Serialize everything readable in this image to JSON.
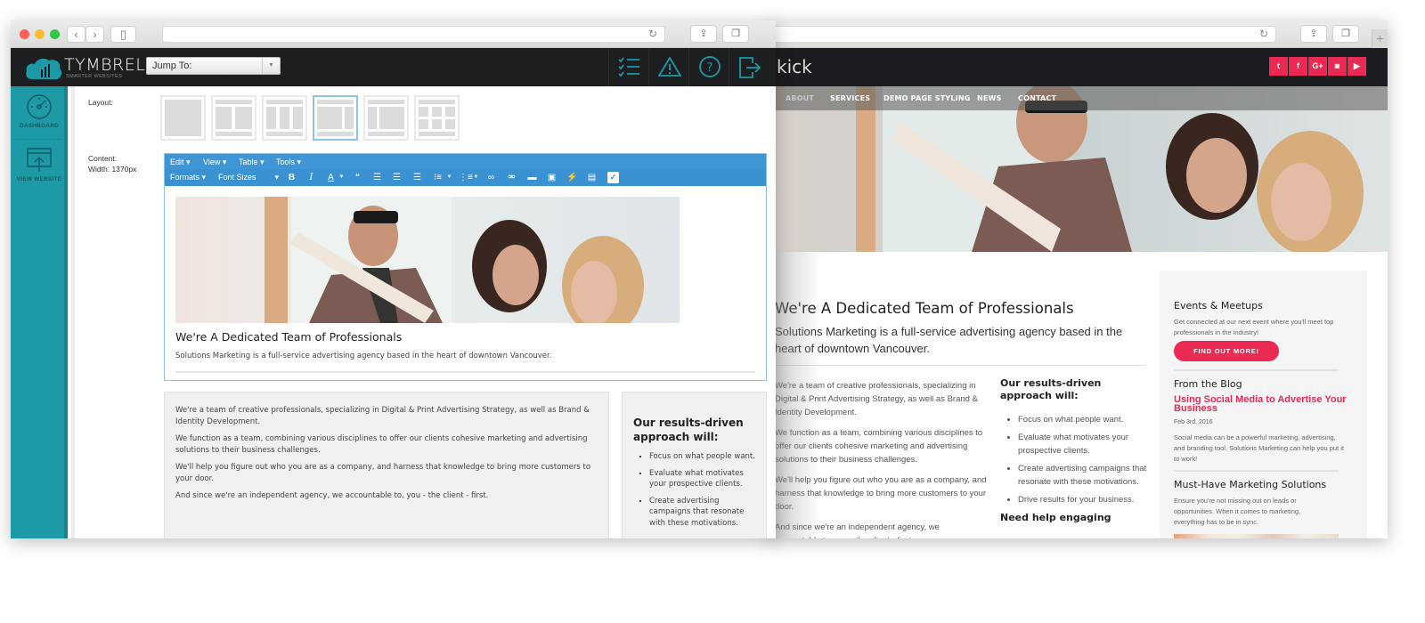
{
  "cms": {
    "brand": "TYMBREL",
    "brand_tagline": "SMARTER WEBSITES",
    "jump_to": {
      "label": "Jump To:",
      "value": ""
    },
    "header_icons": [
      "checklist-icon",
      "warning-icon",
      "help-icon",
      "logout-icon"
    ],
    "sidebar": {
      "items": [
        {
          "label": "DASHBOARD",
          "icon": "dashboard-gauge-icon"
        },
        {
          "label": "VIEW WEBSITE",
          "icon": "view-website-icon"
        }
      ]
    },
    "layout_label": "Layout:",
    "content_label": "Content:",
    "content_width": "Width: 1370px",
    "layout_options": [
      {
        "name": "full-width",
        "selected": false
      },
      {
        "name": "two-column-header-footer",
        "selected": false
      },
      {
        "name": "three-column-header-footer",
        "selected": false
      },
      {
        "name": "main-sidebar-right",
        "selected": true
      },
      {
        "name": "sidebar-left-main",
        "selected": false
      },
      {
        "name": "grid-3x2",
        "selected": false
      }
    ],
    "editor": {
      "menu": [
        "Edit",
        "View",
        "Table",
        "Tools"
      ],
      "formats": "Formats",
      "font_sizes": "Font Sizes",
      "toolbar_icons": [
        "bold-icon",
        "italic-icon",
        "text-color-icon",
        "blockquote-icon",
        "align-left-icon",
        "align-center-icon",
        "align-right-icon",
        "bullet-list-icon",
        "numbered-list-icon",
        "link-icon",
        "unlink-icon",
        "folder-icon",
        "image-icon",
        "magic-wand-icon",
        "media-icon",
        "checkbox-icon"
      ],
      "heading": "We're A Dedicated Team of Professionals",
      "intro": "Solutions Marketing is a full-service advertising agency based in the heart of downtown Vancouver."
    },
    "panel_main": {
      "paragraphs": [
        "We're a team of creative professionals, specializing in Digital & Print Advertising Strategy, as well as Brand & Identity Development.",
        "We function as a team, combining various disciplines to offer our clients cohesive marketing and advertising solutions to their business challenges.",
        "We'll help you figure out who you are as a company, and harness that knowledge to bring more customers to your door.",
        "And since we're an independent agency, we accountable to, you - the client - first."
      ]
    },
    "panel_side": {
      "heading": "Our results-driven approach will:",
      "items": [
        "Focus on what people want.",
        "Evaluate what motivates your prospective clients.",
        "Create advertising campaigns that resonate with these motivations."
      ]
    },
    "colors": {
      "teal": "#1d9aa6",
      "toolbar_blue": "#3f96d6",
      "header_dark": "#1d1e20"
    }
  },
  "site": {
    "logo": "kick",
    "social": [
      {
        "name": "twitter",
        "glyph": "t"
      },
      {
        "name": "facebook",
        "glyph": "f"
      },
      {
        "name": "google-plus",
        "glyph": "G+"
      },
      {
        "name": "instagram",
        "glyph": "◙"
      },
      {
        "name": "youtube",
        "glyph": "▶"
      }
    ],
    "nav": [
      "ABOUT",
      "SERVICES",
      "DEMO PAGE STYLING",
      "NEWS",
      "CONTACT"
    ],
    "heading": "We're A Dedicated Team of Professionals",
    "lead": "Solutions Marketing is a full-service advertising agency based in the heart of downtown Vancouver.",
    "paragraphs": [
      "We're a team of creative professionals, specializing in Digital & Print Advertising Strategy, as well as Brand & Identity Development.",
      "We function as a team, combining various disciplines to offer our clients cohesive marketing and advertising solutions to their business challenges.",
      "We'll help you figure out who you are as a company, and harness that knowledge to bring more customers to your door.",
      "And since we're an independent agency, we accountable to, you - the client - first."
    ],
    "approach": {
      "heading": "Our results-driven approach will:",
      "items": [
        "Focus on what people want.",
        "Evaluate what motivates your prospective clients.",
        "Create advertising campaigns that resonate with these motivations.",
        "Drive results for your business."
      ],
      "next_heading": "Need help engaging"
    },
    "sidebar": {
      "events_heading": "Events & Meetups",
      "events_text": "Get connected at our next event where you'll meet top professionals in the industry!",
      "events_button": "FIND OUT MORE!",
      "blog_heading": "From the Blog",
      "blog_title": "Using Social Media to Advertise Your Business",
      "blog_date": "Feb 3rd, 2016",
      "blog_excerpt": "Social media can be a powerful marketing, advertising, and branding tool. Solutions Marketing can help you put it to work!",
      "solutions_heading": "Must-Have Marketing Solutions",
      "solutions_text": "Ensure you're not missing out on leads or opportunities. When it comes to marketing, everything has to be in sync."
    },
    "colors": {
      "accent": "#ea2a53",
      "header_dark": "#1b1c1f"
    }
  }
}
